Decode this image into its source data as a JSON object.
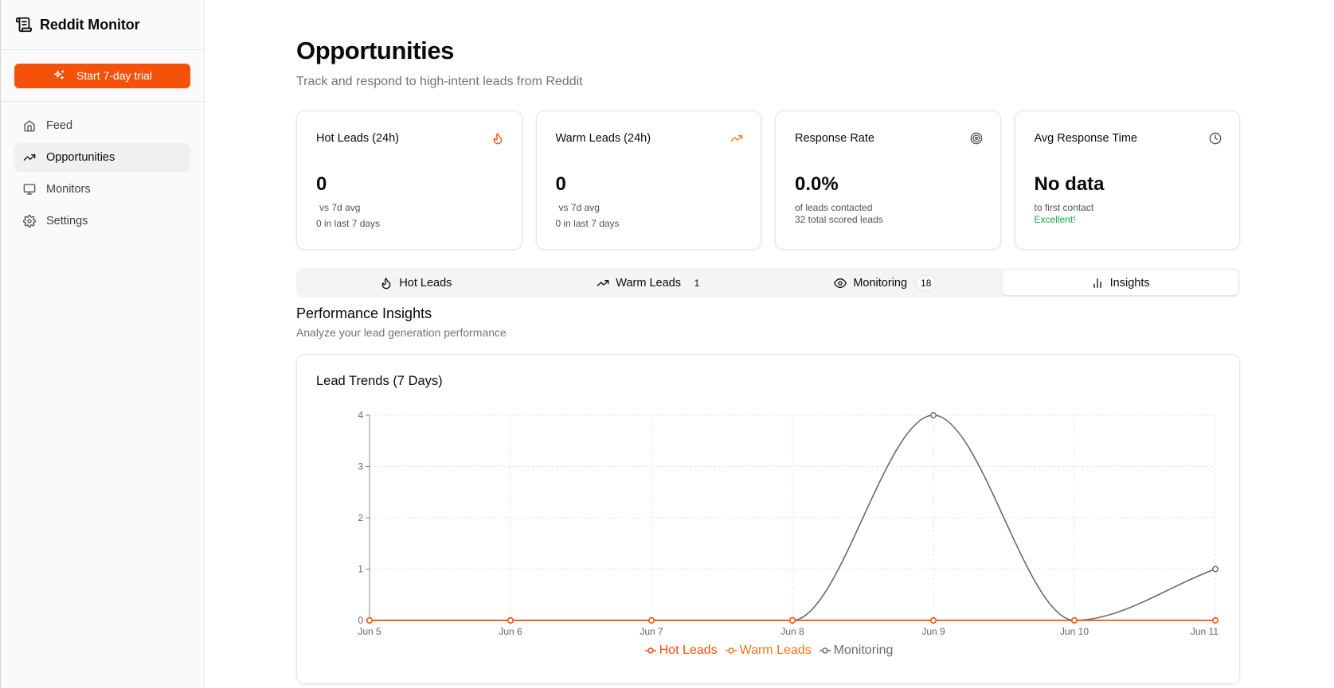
{
  "sidebar": {
    "brand": "Reddit Monitor",
    "trial_button": "Start 7-day trial",
    "items": [
      {
        "label": "Feed",
        "icon": "home-icon",
        "active": false
      },
      {
        "label": "Opportunities",
        "icon": "trending-up-icon",
        "active": true
      },
      {
        "label": "Monitors",
        "icon": "monitor-icon",
        "active": false
      },
      {
        "label": "Settings",
        "icon": "gear-icon",
        "active": false
      }
    ]
  },
  "header": {
    "title": "Opportunities",
    "subtitle": "Track and respond to high-intent leads from Reddit"
  },
  "cards": [
    {
      "title": "Hot Leads (24h)",
      "icon": "flame-icon",
      "value": "0",
      "line1": "vs 7d avg",
      "line2": "0 in last 7 days"
    },
    {
      "title": "Warm Leads (24h)",
      "icon": "trending-up-icon",
      "value": "0",
      "line1": "vs 7d avg",
      "line2": "0 in last 7 days"
    },
    {
      "title": "Response Rate",
      "icon": "target-icon",
      "value": "0.0%",
      "line1": "of leads contacted",
      "line2": "32 total scored leads"
    },
    {
      "title": "Avg Response Time",
      "icon": "clock-icon",
      "value": "No data",
      "line1": "to first contact",
      "line2": "Excellent!"
    }
  ],
  "tabs": [
    {
      "label": "Hot Leads",
      "icon": "flame-icon",
      "badge": ""
    },
    {
      "label": "Warm Leads",
      "icon": "trending-up-icon",
      "badge": "1"
    },
    {
      "label": "Monitoring",
      "icon": "eye-icon",
      "badge": "18"
    },
    {
      "label": "Insights",
      "icon": "bar-chart-icon",
      "badge": ""
    }
  ],
  "active_tab": "Insights",
  "insights": {
    "title": "Performance Insights",
    "subtitle": "Analyze your lead generation performance"
  },
  "colors": {
    "accent": "#f4510b",
    "hot": "#f4510b",
    "warm": "#f97316",
    "monitoring": "#6b6b6b",
    "success": "#16a34a"
  },
  "chart_data": {
    "type": "line",
    "title": "Lead Trends (7 Days)",
    "categories": [
      "Jun 5",
      "Jun 6",
      "Jun 7",
      "Jun 8",
      "Jun 9",
      "Jun 10",
      "Jun 11"
    ],
    "series": [
      {
        "name": "Hot Leads",
        "values": [
          0,
          0,
          0,
          0,
          0,
          0,
          0
        ]
      },
      {
        "name": "Warm Leads",
        "values": [
          0,
          0,
          0,
          0,
          0,
          0,
          0
        ]
      },
      {
        "name": "Monitoring",
        "values": [
          0,
          0,
          0,
          0,
          4,
          0,
          1
        ]
      }
    ],
    "yticks": [
      0,
      1,
      2,
      3,
      4
    ],
    "ylim": [
      0,
      4
    ],
    "grid": true,
    "legend": "bottom"
  }
}
